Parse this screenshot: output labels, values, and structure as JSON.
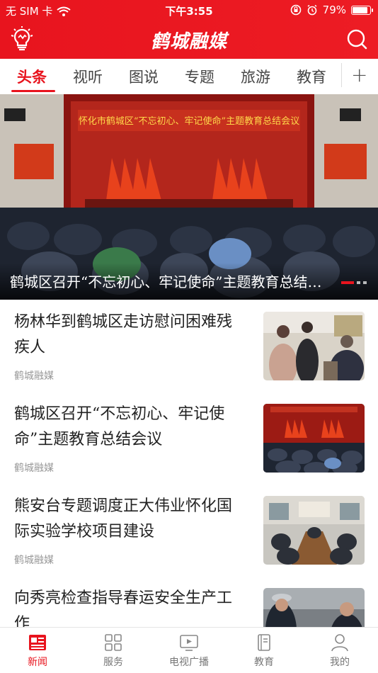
{
  "status_bar": {
    "carrier": "无 SIM 卡",
    "time": "下午3:55",
    "battery": "79%",
    "battery_level": 0.79
  },
  "header": {
    "title": "鹤城融媒",
    "left_icon": "lightbulb-icon",
    "right_icon": "search-icon"
  },
  "tabs": [
    {
      "label": "头条",
      "active": true
    },
    {
      "label": "视听"
    },
    {
      "label": "图说"
    },
    {
      "label": "专题"
    },
    {
      "label": "旅游"
    },
    {
      "label": "教育"
    }
  ],
  "add_tab_label": "+",
  "banner": {
    "caption": "鹤城区召开“不忘初心、牢记使命”主题教育总结会议",
    "stage_banner_text": "怀化市鹤城区“不忘初心、牢记使命”主题教育总结会议",
    "slide_count": 3,
    "active_slide": 1
  },
  "news": [
    {
      "title": "杨林华到鹤城区走访慰问困难残疾人",
      "source": "鹤城融媒",
      "thumb": "people-photo"
    },
    {
      "title": "鹤城区召开“不忘初心、牢记使命”主题教育总结会议",
      "source": "鹤城融媒",
      "thumb": "meeting-hall-photo"
    },
    {
      "title": "熊安台专题调度正大伟业怀化国际实验学校项目建设",
      "source": "鹤城融媒",
      "thumb": "conference-room-photo"
    },
    {
      "title": "向秀亮检查指导春运安全生产工作",
      "source": "",
      "thumb": "traffic-police-photo"
    }
  ],
  "bottom_nav": [
    {
      "label": "新闻",
      "icon": "news-icon",
      "active": true
    },
    {
      "label": "服务",
      "icon": "grid-icon"
    },
    {
      "label": "电视广播",
      "icon": "tv-icon"
    },
    {
      "label": "教育",
      "icon": "book-icon"
    },
    {
      "label": "我的",
      "icon": "user-icon"
    }
  ],
  "colors": {
    "brand_red": "#e8141e",
    "inactive_gray": "#777777",
    "source_gray": "#999999"
  }
}
